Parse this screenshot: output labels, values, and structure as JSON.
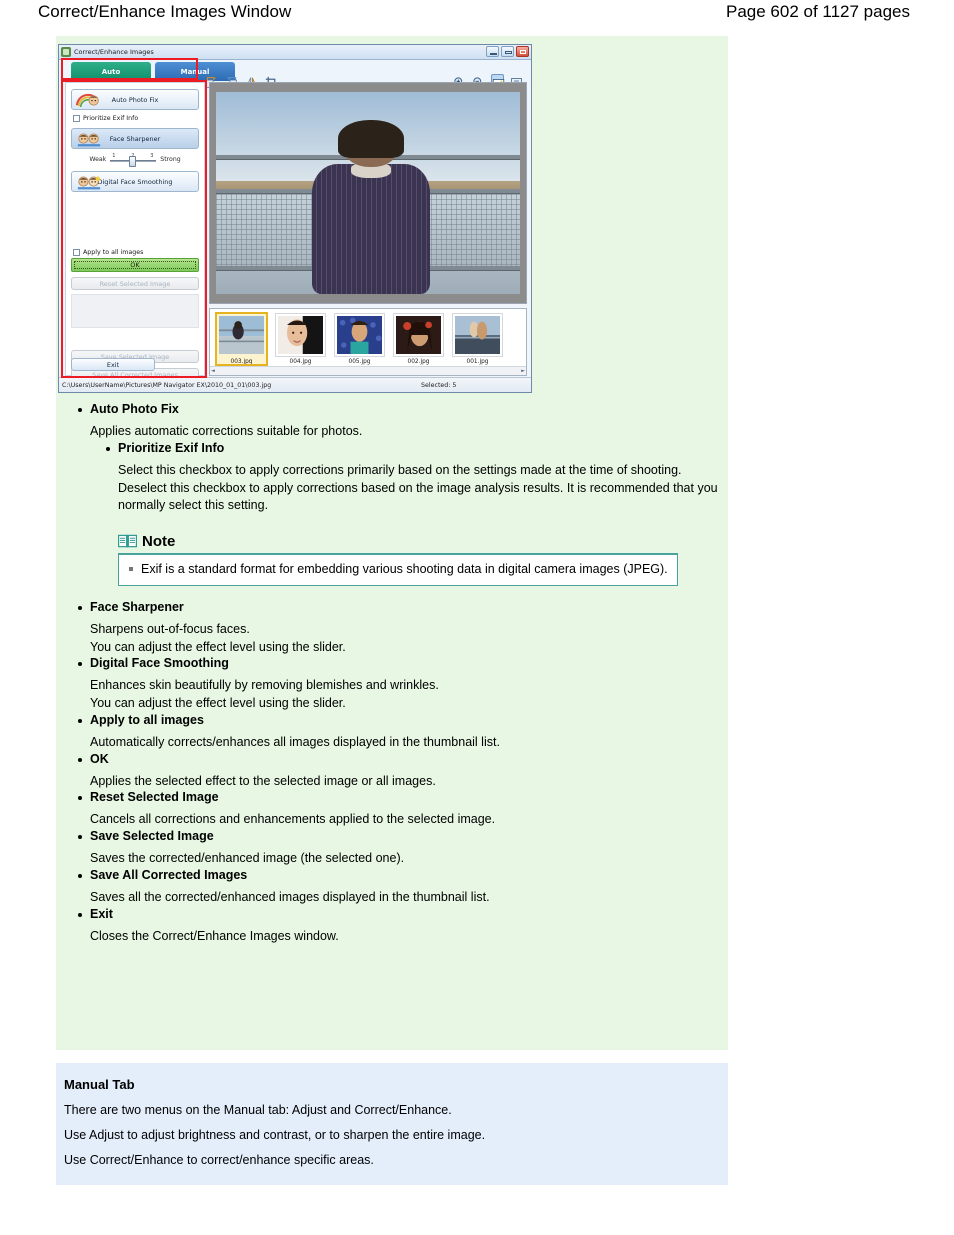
{
  "header": {
    "title": "Correct/Enhance Images Window",
    "page_label": "Page 602 of 1127 pages"
  },
  "app_window": {
    "title": "Correct/Enhance Images",
    "window_icon": "app-icon",
    "buttons": {
      "minimize": "minimize-button",
      "maximize": "maximize-button",
      "close": "close-button"
    },
    "tabs": [
      {
        "label": "Auto",
        "active": true
      },
      {
        "label": "Manual",
        "active": false
      }
    ],
    "toolbar_left": [
      "rotate-left-icon",
      "rotate-right-icon",
      "mirror-icon",
      "crop-icon"
    ],
    "toolbar_right": [
      "zoom-in-icon",
      "zoom-out-icon",
      "fit-to-screen-icon",
      "actual-size-icon"
    ],
    "panel": {
      "auto_photo_fix": "Auto Photo Fix",
      "prioritize_exif": "Prioritize Exif Info",
      "face_sharpener": "Face Sharpener",
      "slider_weak": "Weak",
      "slider_strong": "Strong",
      "slider_ticks": [
        "1",
        "2",
        "3"
      ],
      "slider_value": "2",
      "digital_face_smoothing": "Digital Face Smoothing",
      "apply_to_all": "Apply to all images",
      "ok": "OK",
      "reset_selected": "Reset Selected Image",
      "save_selected": "Save Selected Image",
      "save_all": "Save All Corrected Images",
      "exit": "Exit"
    },
    "thumbnails": [
      {
        "name": "003.jpg",
        "selected": true
      },
      {
        "name": "004.jpg",
        "selected": false
      },
      {
        "name": "005.jpg",
        "selected": false
      },
      {
        "name": "002.jpg",
        "selected": false
      },
      {
        "name": "001.jpg",
        "selected": false
      }
    ],
    "statusbar": {
      "path": "C:\\Users\\UserName\\Pictures\\MP Navigator EX\\2010_01_01\\003.jpg",
      "selected_count": "Selected: 5"
    }
  },
  "doc": {
    "items": [
      {
        "title": "Auto Photo Fix",
        "body": "Applies automatic corrections suitable for photos."
      },
      {
        "title": "Prioritize Exif Info",
        "body": "Select this checkbox to apply corrections primarily based on the settings made at the time of shooting.\nDeselect this checkbox to apply corrections based on the image analysis results. It is recommended that you normally select this setting."
      },
      {
        "title": "Face Sharpener",
        "body": "Sharpens out-of-focus faces.\nYou can adjust the effect level using the slider."
      },
      {
        "title": "Digital Face Smoothing",
        "body": "Enhances skin beautifully by removing blemishes and wrinkles.\nYou can adjust the effect level using the slider."
      },
      {
        "title": "Apply to all images",
        "body": "Automatically corrects/enhances all images displayed in the thumbnail list."
      },
      {
        "title": "OK",
        "body": "Applies the selected effect to the selected image or all images."
      },
      {
        "title": "Reset Selected Image",
        "body": "Cancels all corrections and enhancements applied to the selected image."
      },
      {
        "title": "Save Selected Image",
        "body": "Saves the corrected/enhanced image (the selected one)."
      },
      {
        "title": "Save All Corrected Images",
        "body": "Saves all the corrected/enhanced images displayed in the thumbnail list."
      },
      {
        "title": "Exit",
        "body": "Closes the Correct/Enhance Images window."
      }
    ],
    "note": {
      "icon": "book-icon",
      "label": "Note",
      "text": "Exif is a standard format for embedding various shooting data in digital camera images (JPEG)."
    }
  },
  "manual_section": {
    "heading": "Manual Tab",
    "lines": [
      "There are two menus on the Manual tab: Adjust and Correct/Enhance.",
      "Use Adjust to adjust brightness and contrast, or to sharpen the entire image.",
      "Use Correct/Enhance to correct/enhance specific areas."
    ]
  },
  "colors": {
    "green_panel": "#e7f7e3",
    "blue_panel": "#e4eefb",
    "annotation_red": "#ed1c24",
    "auto_tab": "#0e8f6a",
    "manual_tab": "#2c6bb3",
    "ok_button": "#7fca5a",
    "thumbnail_selected": "#e6b422",
    "note_border": "#4aa39b"
  }
}
